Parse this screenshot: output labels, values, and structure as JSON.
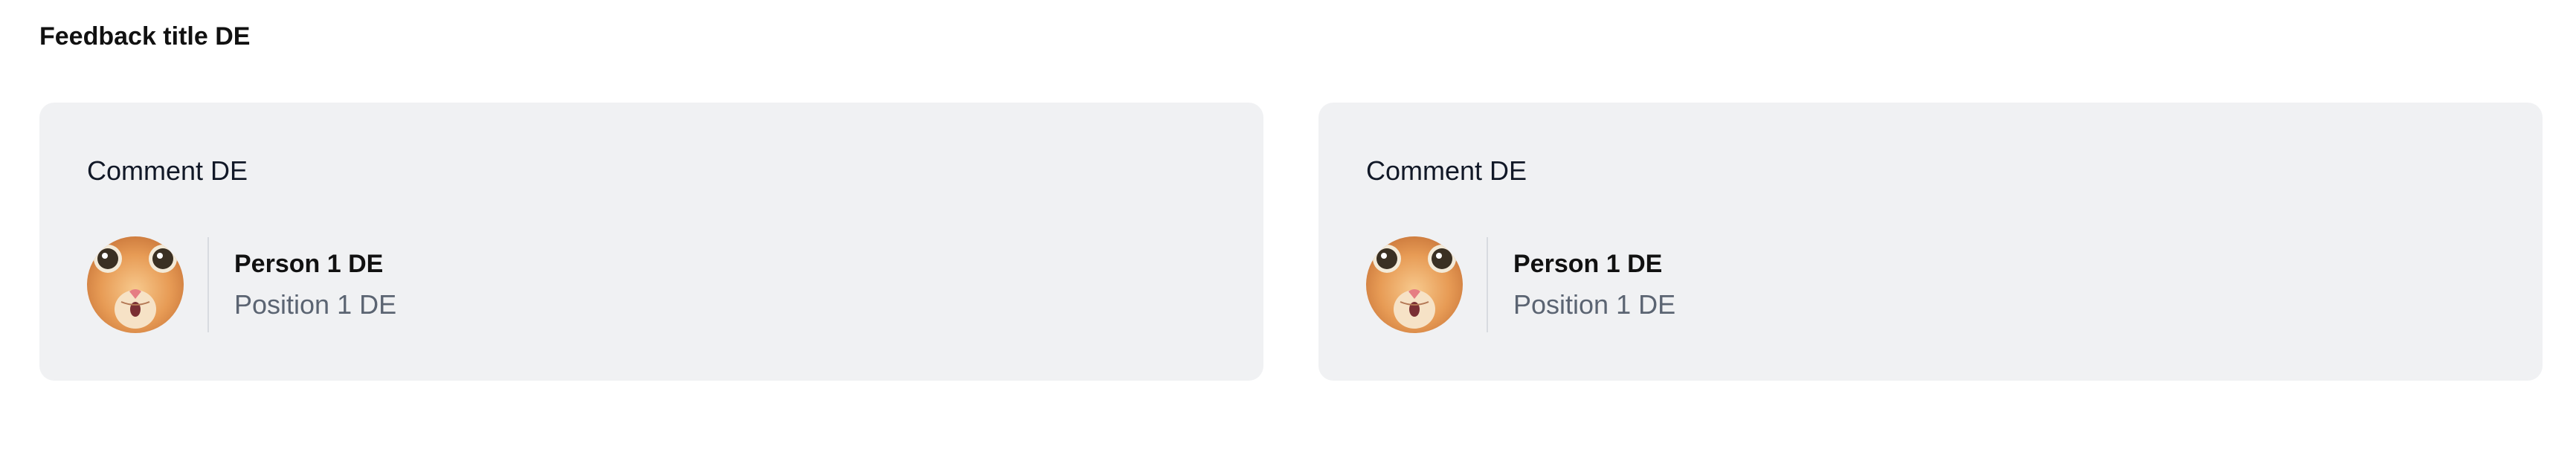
{
  "page": {
    "title": "Feedback title DE"
  },
  "cards": [
    {
      "comment": "Comment DE",
      "person": {
        "name": "Person 1 DE",
        "position": "Position 1 DE",
        "avatar_icon": "cat-avatar-icon"
      }
    },
    {
      "comment": "Comment DE",
      "person": {
        "name": "Person 1 DE",
        "position": "Position 1 DE",
        "avatar_icon": "cat-avatar-icon"
      }
    }
  ],
  "colors": {
    "card_background": "#f0f1f3",
    "title_text": "#111111",
    "secondary_text": "#5b6472",
    "divider": "#d8dbe0"
  }
}
